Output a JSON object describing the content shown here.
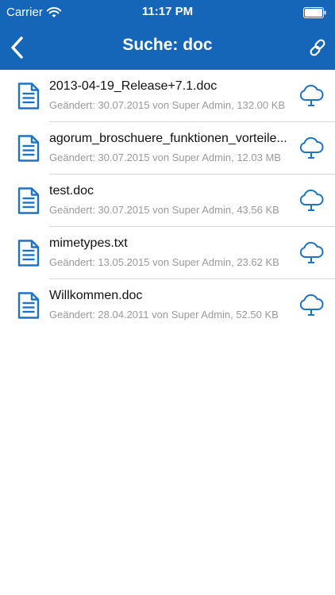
{
  "status_bar": {
    "carrier": "Carrier",
    "time": "11:17 PM"
  },
  "nav": {
    "title": "Suche: doc"
  },
  "colors": {
    "brand": "#1565b9",
    "icon": "#1f73c4"
  },
  "files": [
    {
      "name": "2013-04-19_Release+7.1.doc",
      "meta": "Geändert: 30.07.2015 von Super Admin, 132.00 KB"
    },
    {
      "name": "agorum_broschuere_funktionen_vorteile...",
      "meta": "Geändert: 30.07.2015 von Super Admin, 12.03 MB"
    },
    {
      "name": "test.doc",
      "meta": "Geändert: 30.07.2015 von Super Admin, 43.56 KB"
    },
    {
      "name": "mimetypes.txt",
      "meta": "Geändert: 13.05.2015 von Super Admin, 23.62 KB"
    },
    {
      "name": "Willkommen.doc",
      "meta": "Geändert: 28.04.2011 von Super Admin, 52.50 KB"
    }
  ]
}
